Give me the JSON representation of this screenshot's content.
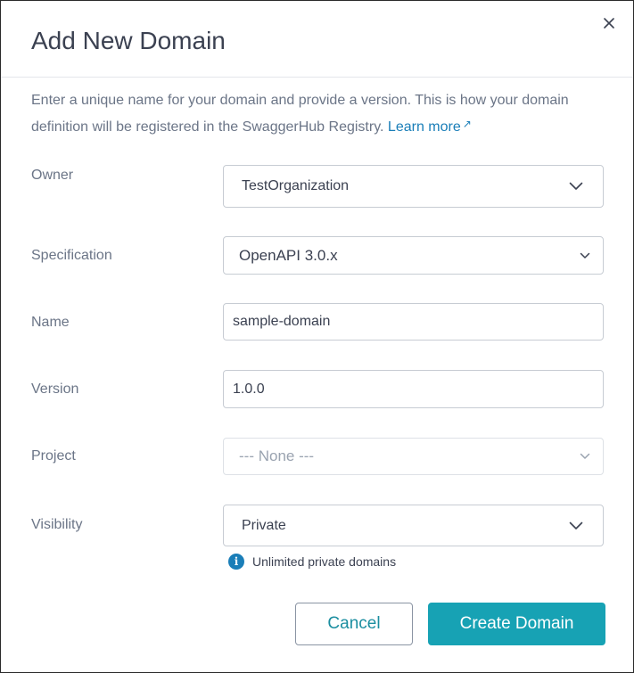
{
  "dialog": {
    "title": "Add New Domain",
    "description": "Enter a unique name for your domain and provide a version. This is how your domain definition will be registered in the SwaggerHub Registry.",
    "learn_more": "Learn more",
    "close_icon": "close-icon"
  },
  "fields": {
    "owner": {
      "label": "Owner",
      "value": "TestOrganization"
    },
    "specification": {
      "label": "Specification",
      "value": "OpenAPI 3.0.x"
    },
    "name": {
      "label": "Name",
      "value": "sample-domain"
    },
    "version": {
      "label": "Version",
      "value": "1.0.0"
    },
    "project": {
      "label": "Project",
      "value": "--- None ---"
    },
    "visibility": {
      "label": "Visibility",
      "value": "Private",
      "hint": "Unlimited private domains"
    }
  },
  "actions": {
    "cancel": "Cancel",
    "create": "Create Domain"
  },
  "colors": {
    "accent": "#17a2b4",
    "link": "#1a7eb8",
    "label": "#6b7587"
  }
}
